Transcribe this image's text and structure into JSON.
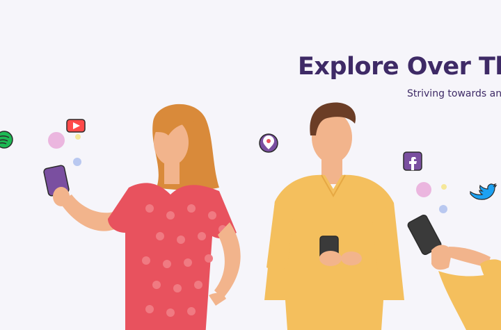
{
  "hero": {
    "title": "Explore Over The W",
    "subtitle": "Striving towards an e"
  },
  "colors": {
    "background": "#f6f5fa",
    "title": "#3e2a66",
    "woman_dress": "#e8525e",
    "man_shirt": "#f4bf5d",
    "phone_purple": "#7a4fa0",
    "spotify": "#1db954",
    "youtube": "#ff0000",
    "periscope": "#7a4fa0",
    "facebook": "#7a4fa0",
    "twitter": "#1da1f2"
  },
  "icons": [
    "spotify-icon",
    "youtube-icon",
    "periscope-icon",
    "facebook-icon",
    "twitter-icon"
  ]
}
